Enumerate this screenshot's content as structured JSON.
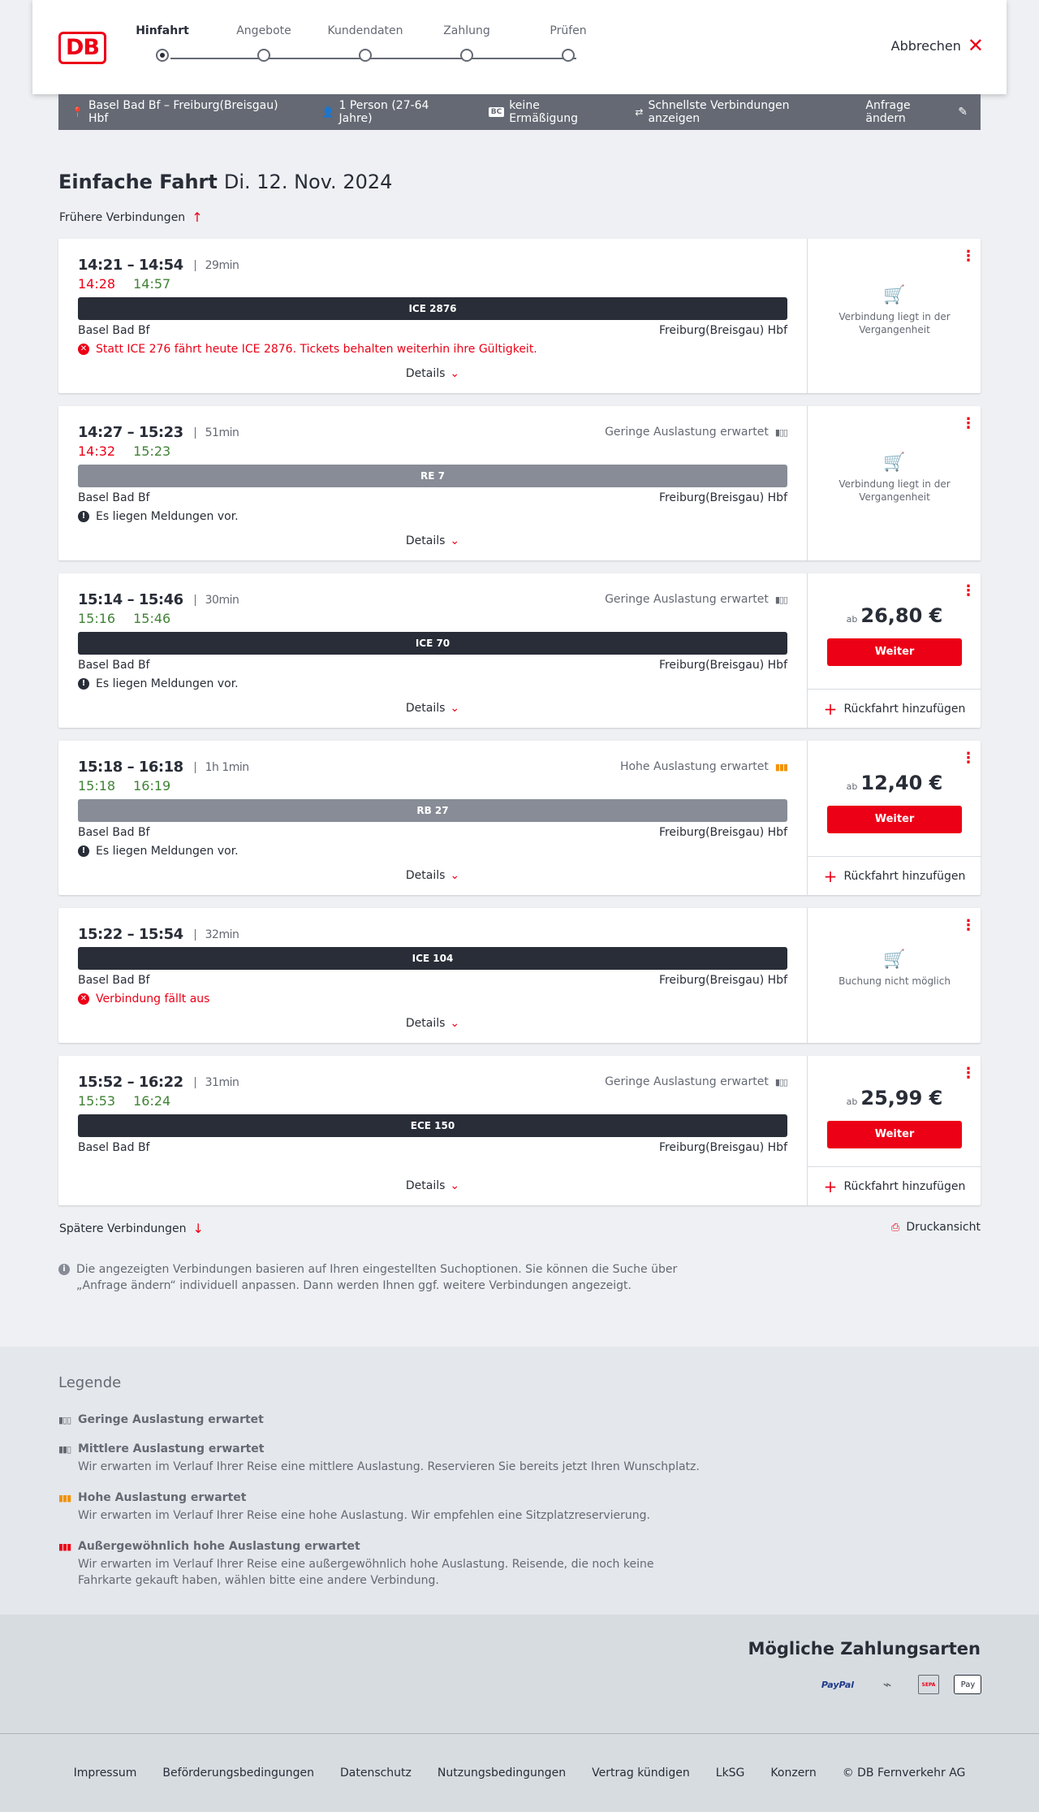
{
  "header": {
    "logo": "DB",
    "steps": [
      "Hinfahrt",
      "Angebote",
      "Kundendaten",
      "Zahlung",
      "Prüfen"
    ],
    "cancel": "Abbrechen"
  },
  "infobar": {
    "route": "Basel Bad Bf – Freiburg(Breisgau) Hbf",
    "persons": "1 Person (27-64 Jahre)",
    "discount_badge": "BC",
    "discount": "keine Ermäßigung",
    "mode": "Schnellste Verbindungen anzeigen",
    "change": "Anfrage ändern"
  },
  "page": {
    "title": "Einfache Fahrt",
    "date": "Di. 12. Nov. 2024",
    "earlier": "Frühere Verbindungen",
    "later": "Spätere Verbindungen",
    "print": "Druckansicht",
    "details": "Details",
    "price_prefix": "ab",
    "continue": "Weiter",
    "return": "Rückfahrt hinzufügen"
  },
  "connections": [
    {
      "times": "14:21 – 14:54",
      "duration": "29min",
      "rt_dep": "14:28",
      "rt_arr": "14:57",
      "train": "ICE 2876",
      "from": "Basel Bad Bf",
      "to": "Freiburg(Breisgau) Hbf",
      "message": "Statt ICE 276 fährt heute ICE 2876. Tickets behalten weiterhin ihre Gültigkeit.",
      "status": "Verbindung liegt in der Vergangenheit"
    },
    {
      "times": "14:27 – 15:23",
      "duration": "51min",
      "rt_dep": "14:32",
      "rt_arr": "15:23",
      "load": "Geringe Auslastung erwartet",
      "train": "RE 7",
      "from": "Basel Bad Bf",
      "to": "Freiburg(Breisgau) Hbf",
      "message": "Es liegen Meldungen vor.",
      "status": "Verbindung liegt in der Vergangenheit"
    },
    {
      "times": "15:14 – 15:46",
      "duration": "30min",
      "rt_dep": "15:16",
      "rt_arr": "15:46",
      "load": "Geringe Auslastung erwartet",
      "train": "ICE 70",
      "from": "Basel Bad Bf",
      "to": "Freiburg(Breisgau) Hbf",
      "message": "Es liegen Meldungen vor.",
      "price": "26,80 €"
    },
    {
      "times": "15:18 – 16:18",
      "duration": "1h 1min",
      "rt_dep": "15:18",
      "rt_arr": "16:19",
      "load": "Hohe Auslastung erwartet",
      "train": "RB 27",
      "from": "Basel Bad Bf",
      "to": "Freiburg(Breisgau) Hbf",
      "message": "Es liegen Meldungen vor.",
      "price": "12,40 €"
    },
    {
      "times": "15:22 – 15:54",
      "duration": "32min",
      "train": "ICE 104",
      "from": "Basel Bad Bf",
      "to": "Freiburg(Breisgau) Hbf",
      "message": "Verbindung fällt aus",
      "status": "Buchung nicht möglich"
    },
    {
      "times": "15:52 – 16:22",
      "duration": "31min",
      "rt_dep": "15:53",
      "rt_arr": "16:24",
      "load": "Geringe Auslastung erwartet",
      "train": "ECE 150",
      "from": "Basel Bad Bf",
      "to": "Freiburg(Breisgau) Hbf",
      "price": "25,99 €"
    }
  ],
  "note": "Die angezeigten Verbindungen basieren auf Ihren eingestellten Suchoptionen. Sie können die Suche über „Anfrage ändern“ individuell anpassen. Dann werden Ihnen ggf. weitere Verbindungen angezeigt.",
  "legend": {
    "title": "Legende",
    "items": [
      {
        "title": "Geringe Auslastung erwartet",
        "desc": ""
      },
      {
        "title": "Mittlere Auslastung erwartet",
        "desc": "Wir erwarten im Verlauf Ihrer Reise eine mittlere Auslastung. Reservieren Sie bereits jetzt Ihren Wunschplatz."
      },
      {
        "title": "Hohe Auslastung erwartet",
        "desc": "Wir erwarten im Verlauf Ihrer Reise eine hohe Auslastung. Wir empfehlen eine Sitzplatzreservierung."
      },
      {
        "title": "Außergewöhnlich hohe Auslastung erwartet",
        "desc": "Wir erwarten im Verlauf Ihrer Reise eine außergewöhnlich hohe Auslastung. Reisende, die noch keine Fahrkarte gekauft haben, wählen bitte eine andere Verbindung."
      }
    ]
  },
  "payment": {
    "title": "Mögliche Zahlungsarten",
    "methods": [
      "PayPal",
      "SEPA",
      "Pay"
    ]
  },
  "footer": [
    "Impressum",
    "Beförderungsbedingungen",
    "Datenschutz",
    "Nutzungsbedingungen",
    "Vertrag kündigen",
    "LkSG",
    "Konzern",
    "© DB Fernverkehr AG"
  ],
  "colors": {
    "brand": "#ec0016",
    "late": "#ec0016",
    "ontime": "#408335",
    "dark": "#282d37",
    "high_load": "#f39200"
  }
}
